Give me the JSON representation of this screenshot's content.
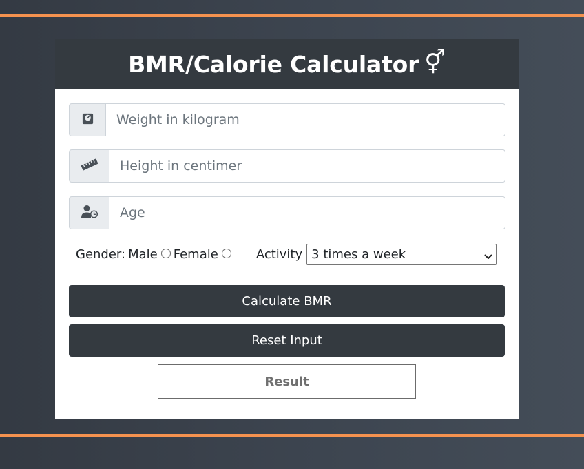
{
  "header": {
    "title": "BMR/Calorie Calculator",
    "title_glyph": "⚥"
  },
  "form": {
    "weight": {
      "placeholder": "Weight in kilogram",
      "value": "",
      "icon": "weight-scale-icon"
    },
    "height": {
      "placeholder": "Height in centimer",
      "value": "",
      "icon": "ruler-icon"
    },
    "age": {
      "placeholder": "Age",
      "value": "",
      "icon": "user-clock-icon"
    },
    "gender": {
      "label": "Gender:",
      "options": [
        "Male",
        "Female"
      ],
      "selected": null
    },
    "activity": {
      "label": "Activity",
      "selected": "3 times a week"
    }
  },
  "buttons": {
    "calculate": "Calculate BMR",
    "reset": "Reset Input",
    "result": "Result"
  },
  "colors": {
    "accent": "#f5924f",
    "dark": "#343a40",
    "background": "#3d4550"
  }
}
